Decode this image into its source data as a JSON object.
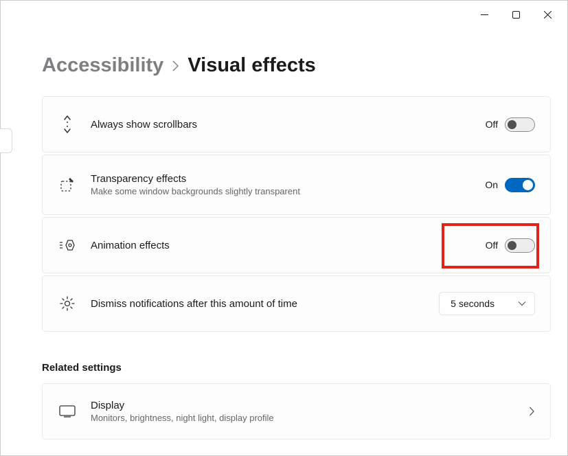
{
  "breadcrumb": {
    "parent": "Accessibility",
    "current": "Visual effects"
  },
  "settings": {
    "scrollbars": {
      "title": "Always show scrollbars",
      "state": "Off"
    },
    "transparency": {
      "title": "Transparency effects",
      "subtitle": "Make some window backgrounds slightly transparent",
      "state": "On"
    },
    "animation": {
      "title": "Animation effects",
      "state": "Off"
    },
    "dismiss": {
      "title": "Dismiss notifications after this amount of time",
      "value": "5 seconds"
    }
  },
  "related": {
    "header": "Related settings",
    "display": {
      "title": "Display",
      "subtitle": "Monitors, brightness, night light, display profile"
    }
  }
}
